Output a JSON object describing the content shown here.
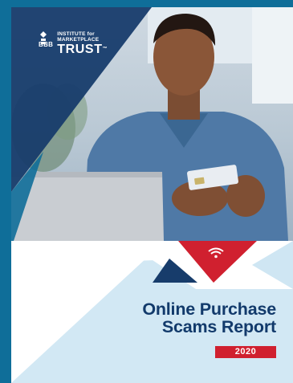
{
  "logo": {
    "bbb": "BBB",
    "line1": "INSTITUTE for",
    "line2": "MARKETPLACE",
    "line3": "TRUST",
    "tm": "™"
  },
  "title": {
    "line1": "Online Purchase",
    "line2": "Scams Report"
  },
  "year": "2020",
  "colors": {
    "navy": "#123a6b",
    "blue": "#0f6e99",
    "red": "#d0202f",
    "light_blue": "#cfe6f3",
    "white": "#ffffff"
  },
  "icons": [
    "torch-icon",
    "wifi-icon"
  ]
}
